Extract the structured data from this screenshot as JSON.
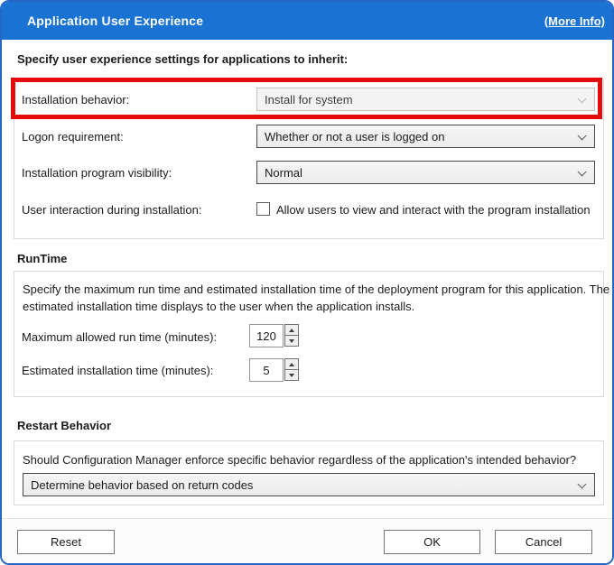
{
  "header": {
    "title": "Application User Experience",
    "more_info_label": "(More Info)"
  },
  "intro_text": "Specify user experience settings for applications to inherit:",
  "settings_rows": [
    {
      "label": "Installation behavior:",
      "value": "Install for system",
      "control": "dropdown",
      "state": "disabled",
      "highlighted": true
    },
    {
      "label": "Logon requirement:",
      "value": "Whether or not a user is logged on",
      "control": "dropdown",
      "state": "enabled"
    },
    {
      "label": "Installation program visibility:",
      "value": "Normal",
      "control": "dropdown",
      "state": "enabled"
    },
    {
      "label": "User interaction during installation:",
      "checkbox_label": "Allow users to view and interact with the program installation",
      "control": "checkbox",
      "checked": false
    }
  ],
  "runtime": {
    "heading": "RunTime",
    "description_lines": [
      "Specify the maximum run time and estimated installation time of the deployment program for this application. The",
      "estimated installation time displays to the user when the application installs."
    ],
    "max_run_time": {
      "label": "Maximum allowed run time (minutes):",
      "value": "120"
    },
    "est_install_time": {
      "label": "Estimated installation time (minutes):",
      "value": "5"
    }
  },
  "restart": {
    "heading": "Restart Behavior",
    "question": "Should Configuration Manager enforce specific behavior regardless of the application's intended behavior?",
    "value": "Determine behavior based on return codes"
  },
  "footer": {
    "reset_label": "Reset",
    "ok_label": "OK",
    "cancel_label": "Cancel"
  },
  "colors": {
    "header_blue": "#1a73d2",
    "dialog_border_blue": "#2667c5",
    "highlight_red": "#e60c0c",
    "groupbox_border": "#d9d9d9"
  }
}
